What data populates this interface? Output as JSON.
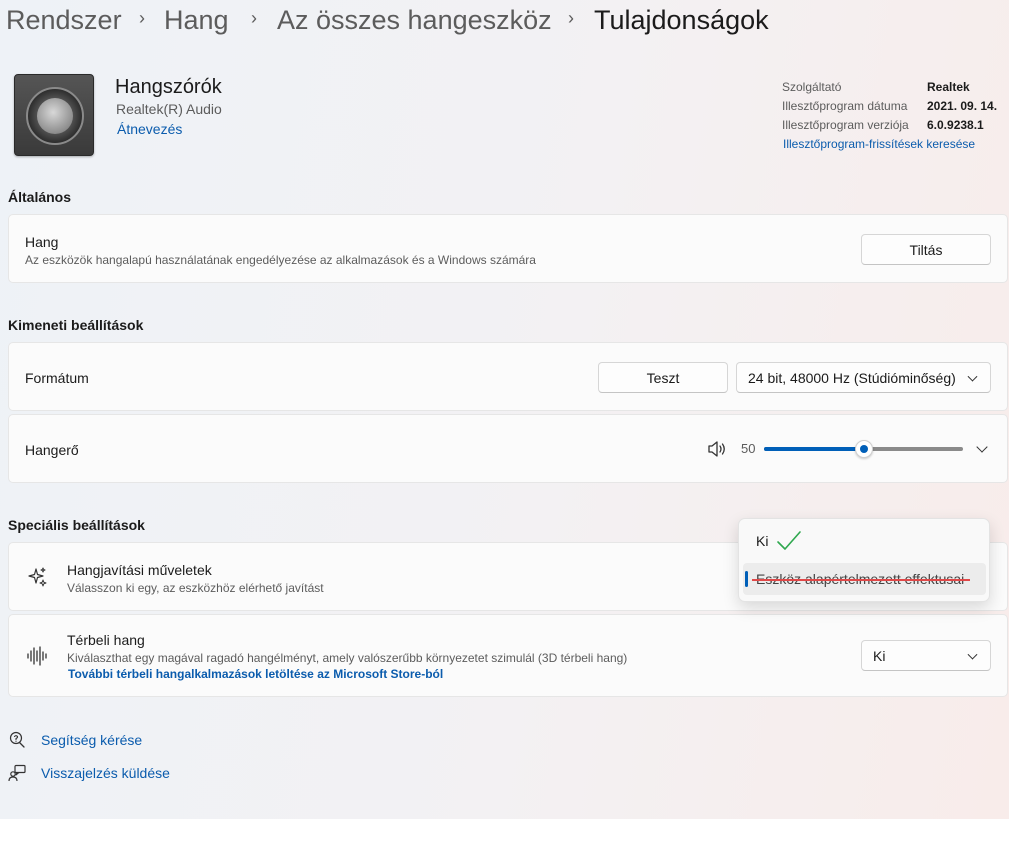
{
  "breadcrumb": {
    "items": [
      "Rendszer",
      "Hang",
      "Az összes hangeszköz",
      "Tulajdonságok"
    ],
    "separator": "›"
  },
  "device": {
    "name": "Hangszórók",
    "driver_name": "Realtek(R) Audio",
    "rename_link": "Átnevezés",
    "icon": "speaker-icon"
  },
  "driver_info": {
    "provider_label": "Szolgáltató",
    "provider_value": "Realtek",
    "date_label": "Illesztőprogram dátuma",
    "date_value": "2021. 09. 14.",
    "version_label": "Illesztőprogram verziója",
    "version_value": "6.0.9238.1",
    "update_link": "Illesztőprogram-frissítések keresése"
  },
  "general": {
    "section_title": "Általános",
    "audio_title": "Hang",
    "audio_desc": "Az eszközök hangalapú használatának engedélyezése az alkalmazások és a Windows számára",
    "disable_button": "Tiltás"
  },
  "output": {
    "section_title": "Kimeneti beállítások",
    "format_label": "Formátum",
    "test_button": "Teszt",
    "format_value": "24 bit, 48000 Hz (Stúdióminőség)",
    "volume_label": "Hangerő",
    "volume_value": "50",
    "volume_level": 50,
    "volume_icon": "speaker-volume-icon"
  },
  "advanced": {
    "section_title": "Speciális beállítások",
    "enhance_title": "Hangjavítási műveletek",
    "enhance_desc": "Válasszon ki egy, az eszközhöz elérhető javítást",
    "enhance_icon": "sparkle-icon",
    "enhance_options": [
      "Ki",
      "Eszköz alapértelmezett effektusai"
    ],
    "spatial_title": "Térbeli hang",
    "spatial_desc": "Kiválaszthat egy magával ragadó hangélményt, amely valószerűbb környezetet szimulál (3D térbeli hang)",
    "spatial_link": "További térbeli hangalkalmazások letöltése az Microsoft Store-ból",
    "spatial_value": "Ki",
    "spatial_icon": "waveform-icon"
  },
  "footer": {
    "help_link": "Segítség kérése",
    "feedback_link": "Visszajelzés küldése"
  },
  "colors": {
    "accent": "#005fb8",
    "link": "#0b5cad",
    "annotation_check": "#2fa84f",
    "annotation_strike": "#e04848"
  }
}
